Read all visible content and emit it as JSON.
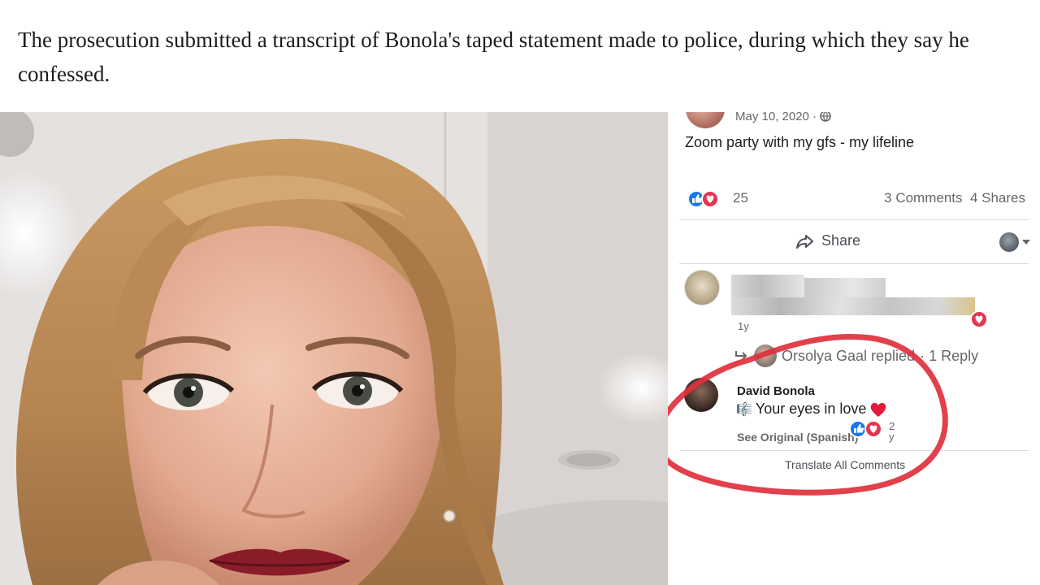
{
  "article": {
    "caption": "The prosecution submitted a transcript of Bonola's taped statement made to police, during which they say he confessed."
  },
  "facebook_post": {
    "date": "May 10, 2020 ·",
    "privacy_icon": "globe-icon",
    "text": "Zoom party with my gfs - my lifeline",
    "reaction_icons": [
      "like-icon",
      "love-icon"
    ],
    "reaction_count": "25",
    "comments_shares": "3 Comments  4 Shares",
    "share_label": "Share",
    "comment": {
      "age": "1y",
      "reply_name": "Orsolya Gaal replied",
      "reply_count": "· 1 Reply"
    },
    "highlighted_comment": {
      "author": "David Bonola",
      "text": "Your eyes in love",
      "see_original": "See Original (Spanish)",
      "reaction_count": "2",
      "age": "y"
    },
    "translate_all": "Translate All Comments"
  },
  "colors": {
    "like_blue": "#1877f2",
    "love_red": "#e4354f",
    "highlight_circle": "#e0303c"
  }
}
